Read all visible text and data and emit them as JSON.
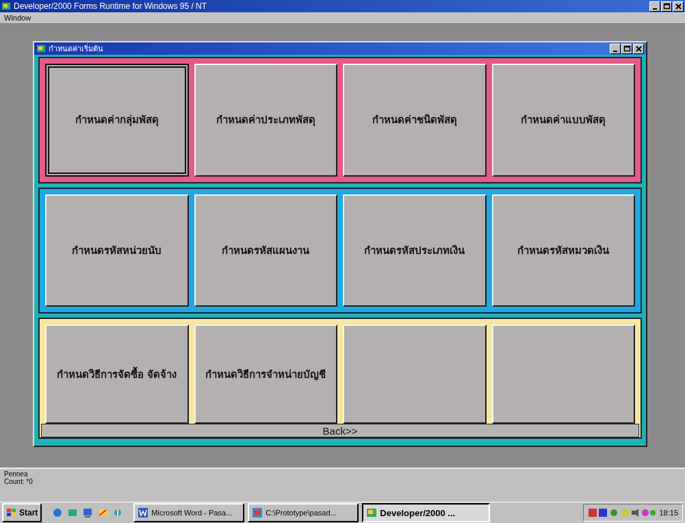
{
  "window": {
    "title": "Developer/2000 Forms Runtime for Windows 95 / NT"
  },
  "menu": [
    {
      "label": "Window"
    }
  ],
  "form": {
    "title": "กำหนดค่าเริ่มต้น",
    "panels": [
      {
        "color": "#e8588a",
        "buttons": [
          {
            "label": "กำหนดค่ากลุ่มพัสดุ",
            "focused": true
          },
          {
            "label": "กำหนดค่าประเภทพัสดุ",
            "focused": false
          },
          {
            "label": "กำหนดค่าชนิดพัสดุ",
            "focused": false
          },
          {
            "label": "กำหนดค่าแบบพัสดุ",
            "focused": false
          }
        ]
      },
      {
        "color": "#1ea8e4",
        "buttons": [
          {
            "label": "กำหนดรหัสหน่วยนับ",
            "focused": false
          },
          {
            "label": "กำหนดรหัสแผนงาน",
            "focused": false
          },
          {
            "label": "กำหนดรหัสประเภทเงิน",
            "focused": false
          },
          {
            "label": "กำหนดรหัสหมวดเงิน",
            "focused": false
          }
        ]
      },
      {
        "color": "#f8e6a0",
        "buttons": [
          {
            "label": "กำหนดวิธีการจัดซื้อ จัดจ้าง",
            "focused": false
          },
          {
            "label": "กำหนดวิธีการจำหน่ายบัญชี",
            "focused": false
          },
          {
            "focused": false
          },
          {
            "focused": false
          }
        ]
      }
    ],
    "back_button": {
      "label": "Back>>"
    }
  },
  "status_bar": {
    "lines": [
      "Pennea",
      "Count: *0"
    ]
  },
  "taskbar": {
    "start": "Start",
    "tasks": [
      {
        "label": "Microsoft Word - Pasa...",
        "selected": false
      },
      {
        "label": "C:\\Prototype\\pasad...",
        "selected": false
      },
      {
        "label": "Developer/2000 ...",
        "selected": true
      }
    ],
    "clock": "18:15"
  }
}
